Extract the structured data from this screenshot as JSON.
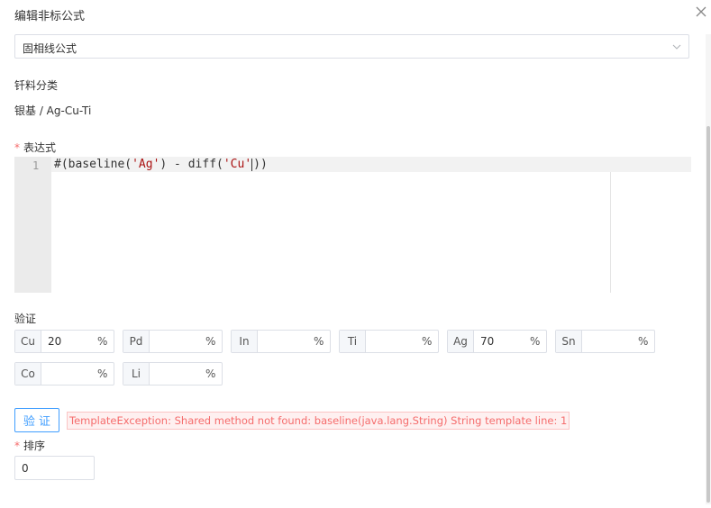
{
  "dialog": {
    "title": "编辑非标公式"
  },
  "formula_type": {
    "selected": "固相线公式"
  },
  "solder_category": {
    "label": "钎料分类",
    "value": "银基 / Ag-Cu-Ti"
  },
  "expression": {
    "label": "表达式",
    "required_mark": "*",
    "line_number": "1",
    "code_parts": [
      "#(baseline(",
      "'Ag'",
      ") - diff(",
      "'Cu'",
      "))"
    ]
  },
  "validation": {
    "label": "验证",
    "unit": "%",
    "fields": [
      {
        "element": "Cu",
        "value": "20"
      },
      {
        "element": "Pd",
        "value": ""
      },
      {
        "element": "In",
        "value": ""
      },
      {
        "element": "Ti",
        "value": ""
      },
      {
        "element": "Ag",
        "value": "70"
      },
      {
        "element": "Sn",
        "value": ""
      },
      {
        "element": "Co",
        "value": ""
      },
      {
        "element": "Li",
        "value": ""
      }
    ],
    "button_label": "验 证",
    "error_message": "TemplateException: Shared method not found: baseline(java.lang.String) String template line: 1"
  },
  "sort": {
    "label": "排序",
    "required_mark": "*",
    "value": "0"
  },
  "colors": {
    "primary": "#409eff",
    "danger": "#f56c6c"
  },
  "icons": {
    "close": "close-icon",
    "dropdown": "chevron-down-icon"
  }
}
